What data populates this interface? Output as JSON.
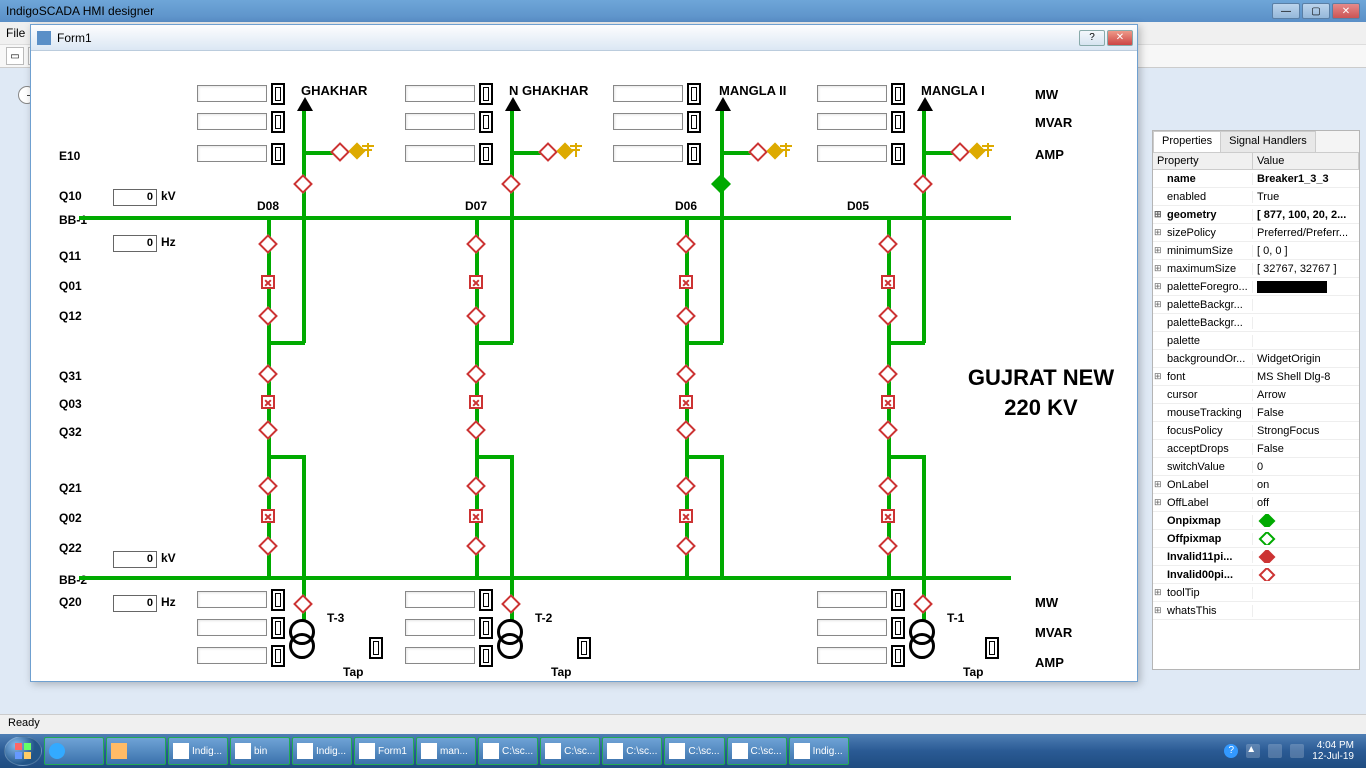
{
  "app": {
    "title": "IndigoSCADA HMI designer"
  },
  "menu": {
    "file": "File"
  },
  "formWindow": {
    "title": "Form1"
  },
  "hmi": {
    "station_title": "GUJRAT NEW",
    "station_kv": "220 KV",
    "feeders": {
      "f1": "GHAKHAR",
      "f2": "N GHAKHAR",
      "f3": "MANGLA II",
      "f4": "MANGLA I"
    },
    "units": {
      "mw": "MW",
      "mvar": "MVAR",
      "amp": "AMP"
    },
    "side": {
      "e10": "E10",
      "q10": "Q10",
      "bb1": "BB-1",
      "q11": "Q11",
      "q01": "Q01",
      "q12": "Q12",
      "q31": "Q31",
      "q03": "Q03",
      "q32": "Q32",
      "q21": "Q21",
      "q02": "Q02",
      "q22": "Q22",
      "bb2": "BB-2",
      "q20": "Q20"
    },
    "dlabels": {
      "d08": "D08",
      "d07": "D07",
      "d06": "D06",
      "d05": "D05"
    },
    "kv": "kV",
    "hz": "Hz",
    "tap": "Tap",
    "xfmr": {
      "t1": "T-1",
      "t2": "T-2",
      "t3": "T-3"
    },
    "val0": "0"
  },
  "props": {
    "tab1": "Properties",
    "tab2": "Signal Handlers",
    "head1": "Property",
    "head2": "Value",
    "rows": [
      {
        "k": "name",
        "v": "Breaker1_3_3",
        "bold": true
      },
      {
        "k": "enabled",
        "v": "True"
      },
      {
        "k": "geometry",
        "v": "[ 877, 100, 20, 2...",
        "exp": true,
        "bold": true
      },
      {
        "k": "sizePolicy",
        "v": "Preferred/Preferr...",
        "exp": true
      },
      {
        "k": "minimumSize",
        "v": "[ 0, 0 ]",
        "exp": true
      },
      {
        "k": "maximumSize",
        "v": "[ 32767, 32767 ]",
        "exp": true
      },
      {
        "k": "paletteForegro...",
        "v": "__BLACK__",
        "exp": true
      },
      {
        "k": "paletteBackgr...",
        "v": "",
        "exp": true
      },
      {
        "k": "paletteBackgr...",
        "v": ""
      },
      {
        "k": "palette",
        "v": ""
      },
      {
        "k": "backgroundOr...",
        "v": "WidgetOrigin"
      },
      {
        "k": "font",
        "v": "MS Shell Dlg-8",
        "exp": true
      },
      {
        "k": "cursor",
        "v": "Arrow"
      },
      {
        "k": "mouseTracking",
        "v": "False"
      },
      {
        "k": "focusPolicy",
        "v": "StrongFocus"
      },
      {
        "k": "acceptDrops",
        "v": "False"
      },
      {
        "k": "switchValue",
        "v": "0"
      },
      {
        "k": "OnLabel",
        "v": "on",
        "exp": true
      },
      {
        "k": "OffLabel",
        "v": "off",
        "exp": true
      },
      {
        "k": "Onpixmap",
        "v": "__GF__",
        "bold": true
      },
      {
        "k": "Offpixmap",
        "v": "__GO__",
        "bold": true
      },
      {
        "k": "Invalid11pi...",
        "v": "__RF__",
        "bold": true
      },
      {
        "k": "Invalid00pi...",
        "v": "__RO__",
        "bold": true
      },
      {
        "k": "toolTip",
        "v": "",
        "exp": true
      },
      {
        "k": "whatsThis",
        "v": "",
        "exp": true
      }
    ]
  },
  "statusbar": {
    "text": "Ready"
  },
  "taskbar": {
    "items": [
      "Indig...",
      "bin",
      "Indig...",
      "Form1",
      "man...",
      "C:\\sc...",
      "C:\\sc...",
      "C:\\sc...",
      "C:\\sc...",
      "C:\\sc...",
      "Indig..."
    ],
    "time": "4:04 PM",
    "date": "12-Jul-19"
  }
}
